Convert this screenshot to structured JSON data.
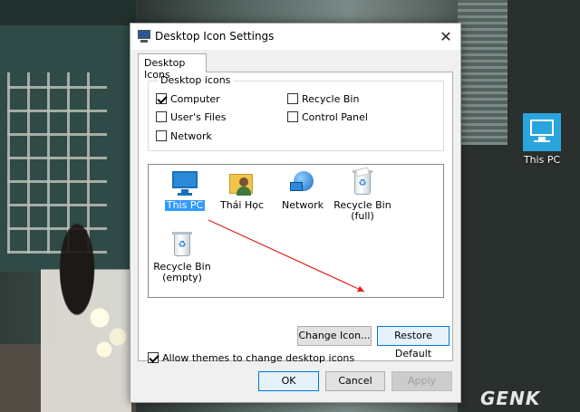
{
  "dialog": {
    "title": "Desktop Icon Settings",
    "close_glyph": "✕",
    "tab_label": "Desktop Icons",
    "group_label": "Desktop icons",
    "checkboxes": [
      {
        "label": "Computer",
        "checked": true
      },
      {
        "label": "User's Files",
        "checked": false
      },
      {
        "label": "Network",
        "checked": false
      },
      {
        "label": "Recycle Bin",
        "checked": false
      },
      {
        "label": "Control Panel",
        "checked": false
      }
    ],
    "icon_items": [
      {
        "label": "This PC",
        "icon": "this-pc-icon",
        "selected": true
      },
      {
        "label": "Thái Học",
        "icon": "user-folder-icon",
        "selected": false
      },
      {
        "label": "Network",
        "icon": "network-icon",
        "selected": false
      },
      {
        "label": "Recycle Bin (full)",
        "label_line1": "Recycle Bin",
        "label_line2": "(full)",
        "icon": "recycle-bin-full-icon",
        "selected": false
      },
      {
        "label": "Recycle Bin (empty)",
        "label_line1": "Recycle Bin",
        "label_line2": "(empty)",
        "icon": "recycle-bin-empty-icon",
        "selected": false
      }
    ],
    "change_icon_label": "Change Icon...",
    "restore_default_label": "Restore Default",
    "allow_themes_label": "Allow themes to change desktop icons",
    "allow_themes_checked": true,
    "ok_label": "OK",
    "cancel_label": "Cancel",
    "apply_label": "Apply"
  },
  "desktop": {
    "icon_label": "This PC",
    "watermark": "GENK"
  },
  "colors": {
    "selection": "#3399ff",
    "accent_blue": "#0078d7",
    "annotation_arrow": "#e0201e"
  }
}
